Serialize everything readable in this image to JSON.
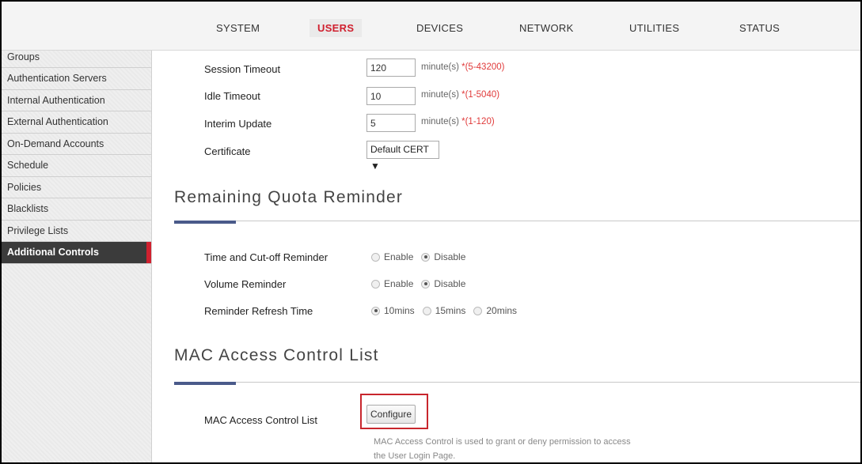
{
  "topnav": {
    "tabs": [
      {
        "label": "SYSTEM"
      },
      {
        "label": "USERS"
      },
      {
        "label": "DEVICES"
      },
      {
        "label": "NETWORK"
      },
      {
        "label": "UTILITIES"
      },
      {
        "label": "STATUS"
      }
    ],
    "active_tab": "USERS"
  },
  "sidebar": {
    "items": [
      {
        "label": "Groups"
      },
      {
        "label": "Authentication Servers"
      },
      {
        "label": "Internal Authentication"
      },
      {
        "label": "External Authentication"
      },
      {
        "label": "On-Demand Accounts"
      },
      {
        "label": "Schedule"
      },
      {
        "label": "Policies"
      },
      {
        "label": "Blacklists"
      },
      {
        "label": "Privilege Lists"
      },
      {
        "label": "Additional Controls"
      }
    ],
    "active_item": "Additional Controls"
  },
  "settings": {
    "session_timeout": {
      "label": "Session Timeout",
      "value": "120",
      "unit": "minute(s) ",
      "range": "*(5-43200)"
    },
    "idle_timeout": {
      "label": "Idle Timeout",
      "value": "10",
      "unit": "minute(s) ",
      "range": "*(1-5040)"
    },
    "interim_update": {
      "label": "Interim Update",
      "value": "5",
      "unit": "minute(s) ",
      "range": "*(1-120)"
    },
    "certificate": {
      "label": "Certificate",
      "selected": "Default CERT ▼"
    }
  },
  "quota_reminder": {
    "title": "Remaining Quota Reminder",
    "time_cutoff": {
      "label": "Time and Cut-off Reminder",
      "options": [
        "Enable",
        "Disable"
      ],
      "selected": "Disable"
    },
    "volume": {
      "label": "Volume Reminder",
      "options": [
        "Enable",
        "Disable"
      ],
      "selected": "Disable"
    },
    "refresh": {
      "label": "Reminder Refresh Time",
      "options": [
        "10mins",
        "15mins",
        "20mins"
      ],
      "selected": "10mins"
    }
  },
  "mac_acl": {
    "title": "MAC Access Control List",
    "label": "MAC Access Control List",
    "button_label": "Configure",
    "description_line1": "MAC Access Control is used to grant or deny permission to access",
    "description_line2": "the User Login Page."
  },
  "colors": {
    "accent_red": "#d0202f",
    "section_accent": "#4a5a8a",
    "sidebar_active_bg": "#3b3b3b",
    "required_text": "#e03a3a"
  }
}
